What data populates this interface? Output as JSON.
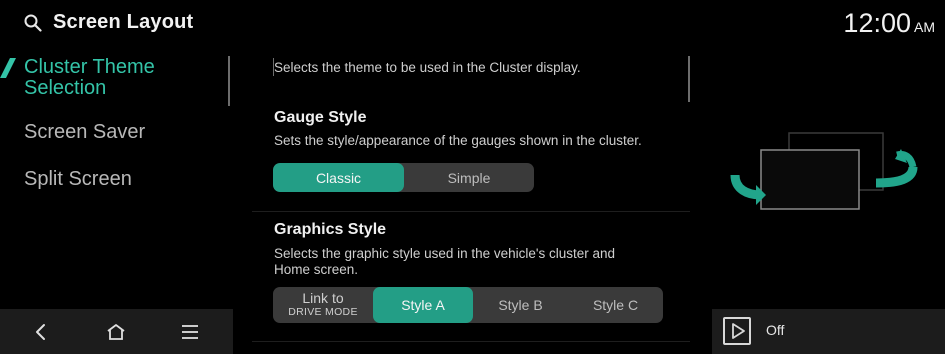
{
  "header": {
    "title": "Screen Layout",
    "time": "12:00",
    "ampm": "AM",
    "search_icon": "search-icon"
  },
  "menu": {
    "items": [
      {
        "label_line1": "Cluster Theme",
        "label_line2": "Selection",
        "active": true
      },
      {
        "label": "Screen Saver",
        "active": false
      },
      {
        "label": "Split Screen",
        "active": false
      }
    ]
  },
  "content": {
    "top_description": "Selects the theme to be used in the Cluster display.",
    "gauge": {
      "title": "Gauge Style",
      "description": "Sets the style/appearance of the gauges shown in the cluster.",
      "options": [
        "Classic",
        "Simple"
      ],
      "selected": "Classic"
    },
    "graphics": {
      "title": "Graphics Style",
      "description_line1": "Selects the graphic style used in the vehicle's cluster and",
      "description_line2": "Home screen.",
      "link_line1": "Link to",
      "link_line2": "DRIVE MODE",
      "options": [
        "Style A",
        "Style B",
        "Style C"
      ],
      "selected": "Style A"
    }
  },
  "bottom_nav": {
    "icons": [
      "back-icon",
      "home-icon",
      "menu-icon"
    ]
  },
  "media": {
    "icon": "play-icon",
    "label": "Off"
  },
  "colors": {
    "accent": "#34c4a8",
    "selected_fill": "#239e86",
    "segment_bg": "#3a3a3a",
    "panel_bg": "#1c1c1c"
  }
}
